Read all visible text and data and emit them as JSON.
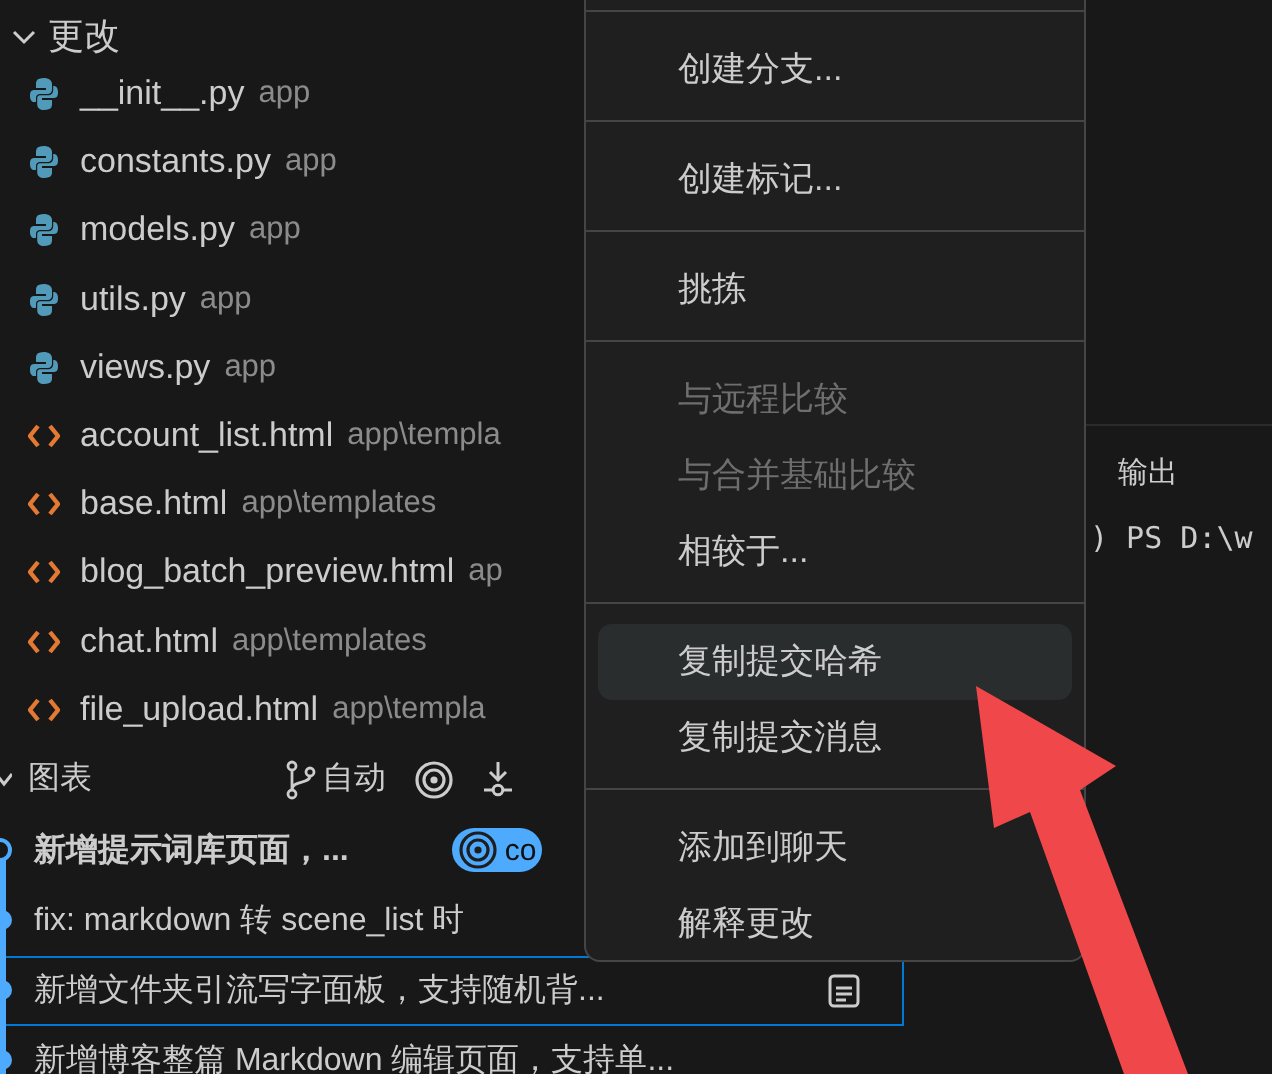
{
  "changes": {
    "title": "更改",
    "expanded": true,
    "files": [
      {
        "name": "__init__.py",
        "path": "app",
        "kind": "python"
      },
      {
        "name": "constants.py",
        "path": "app",
        "kind": "python"
      },
      {
        "name": "models.py",
        "path": "app",
        "kind": "python"
      },
      {
        "name": "utils.py",
        "path": "app",
        "kind": "python"
      },
      {
        "name": "views.py",
        "path": "app",
        "kind": "python"
      },
      {
        "name": "account_list.html",
        "path": "app\\templa",
        "kind": "html"
      },
      {
        "name": "base.html",
        "path": "app\\templates",
        "kind": "html"
      },
      {
        "name": "blog_batch_preview.html",
        "path": "ap",
        "kind": "html"
      },
      {
        "name": "chat.html",
        "path": "app\\templates",
        "kind": "html"
      },
      {
        "name": "file_upload.html",
        "path": "app\\templa",
        "kind": "html"
      }
    ]
  },
  "graph": {
    "title": "图表",
    "expanded": true,
    "branch_label": "自动",
    "commits": [
      {
        "message": "新增提示词库页面，...",
        "head": true,
        "selected": false,
        "badge": "co"
      },
      {
        "message": "fix: markdown 转 scene_list 时",
        "head": false,
        "selected": false
      },
      {
        "message": "新增文件夹引流写字面板，支持随机背...",
        "head": false,
        "selected": true
      },
      {
        "message": "新增博客整篇 Markdown 编辑页面，支持单...",
        "head": false,
        "selected": false
      }
    ]
  },
  "terminal": {
    "tabs": [
      {
        "label": "输出"
      }
    ],
    "line": ") PS D:\\w"
  },
  "context_menu": {
    "groups": [
      [
        {
          "label": "创建分支...",
          "disabled": false,
          "selected": false
        }
      ],
      [
        {
          "label": "创建标记...",
          "disabled": false,
          "selected": false
        }
      ],
      [
        {
          "label": "挑拣",
          "disabled": false,
          "selected": false
        }
      ],
      [
        {
          "label": "与远程比较",
          "disabled": true,
          "selected": false
        },
        {
          "label": "与合并基础比较",
          "disabled": true,
          "selected": false
        },
        {
          "label": "相较于...",
          "disabled": false,
          "selected": false
        }
      ],
      [
        {
          "label": "复制提交哈希",
          "disabled": false,
          "selected": true
        },
        {
          "label": "复制提交消息",
          "disabled": false,
          "selected": false
        }
      ],
      [
        {
          "label": "添加到聊天",
          "disabled": false,
          "selected": false
        },
        {
          "label": "解释更改",
          "disabled": false,
          "selected": false
        }
      ]
    ]
  }
}
